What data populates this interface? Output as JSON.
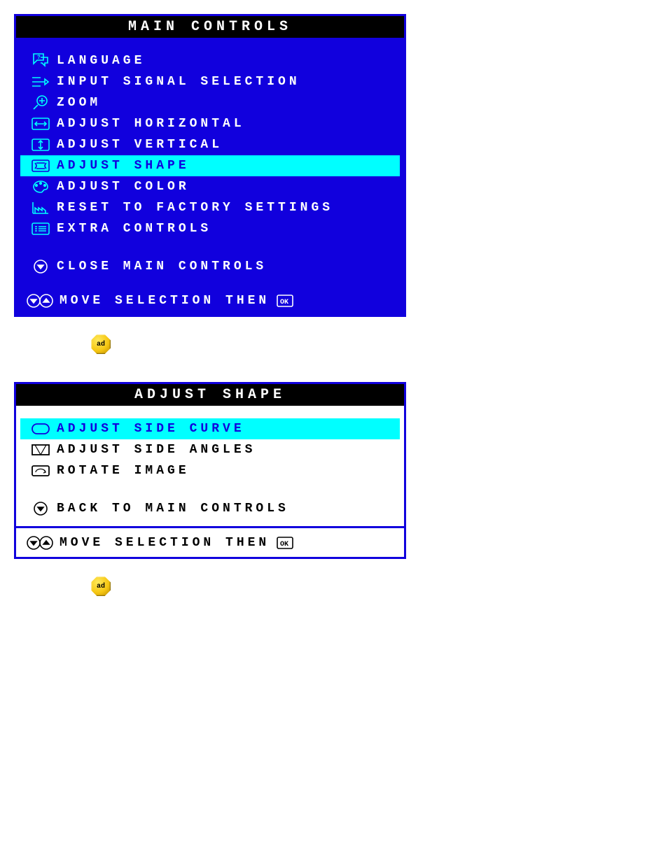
{
  "main_controls": {
    "title": "MAIN CONTROLS",
    "items": [
      {
        "icon": "speech-bubble-icon",
        "label": "LANGUAGE"
      },
      {
        "icon": "input-arrow-icon",
        "label": "INPUT SIGNAL SELECTION"
      },
      {
        "icon": "zoom-icon",
        "label": "ZOOM"
      },
      {
        "icon": "adjust-horizontal-icon",
        "label": "ADJUST HORIZONTAL"
      },
      {
        "icon": "adjust-vertical-icon",
        "label": "ADJUST VERTICAL"
      },
      {
        "icon": "adjust-shape-icon",
        "label": "ADJUST SHAPE",
        "highlight": true
      },
      {
        "icon": "palette-icon",
        "label": "ADJUST COLOR"
      },
      {
        "icon": "factory-icon",
        "label": "RESET TO FACTORY SETTINGS"
      },
      {
        "icon": "list-icon",
        "label": "EXTRA CONTROLS"
      }
    ],
    "close_label": "CLOSE MAIN CONTROLS",
    "footer_label": "MOVE SELECTION THEN"
  },
  "adjust_shape": {
    "title": "ADJUST SHAPE",
    "items": [
      {
        "icon": "side-curve-icon",
        "label": "ADJUST SIDE CURVE",
        "highlight": true
      },
      {
        "icon": "side-angles-icon",
        "label": "ADJUST SIDE ANGLES"
      },
      {
        "icon": "rotate-image-icon",
        "label": "ROTATE IMAGE"
      }
    ],
    "back_label": "BACK TO MAIN CONTROLS",
    "footer_label": "MOVE SELECTION THEN"
  },
  "ok_text": "ad"
}
